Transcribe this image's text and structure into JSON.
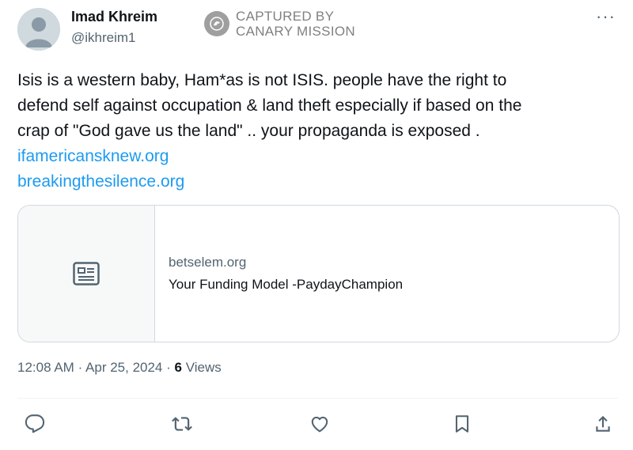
{
  "author": {
    "name": "Imad Khreim",
    "handle": "@ikhreim1"
  },
  "watermark": {
    "line1": "CAPTURED BY",
    "line2": "CANARY MISSION"
  },
  "more_label": "···",
  "tweet": {
    "line1": "Isis is a western baby, Ham*as is not ISIS.  people have the right to",
    "line2": "defend self against occupation & land theft especially if based on the",
    "line3": "crap of \"God gave us the land\"  .. your propaganda is exposed .",
    "link1": "ifamericansknew.org",
    "link2": "breakingthesilence.org"
  },
  "card": {
    "domain": "betselem.org",
    "title": "Your Funding Model -PaydayChampion",
    "icon": "article-icon"
  },
  "meta": {
    "time": "12:08 AM",
    "separator": "·",
    "date": "Apr 25, 2024",
    "views_count": "6",
    "views_label": "Views"
  },
  "actions": [
    "reply-icon",
    "retweet-icon",
    "like-icon",
    "bookmark-icon",
    "share-icon"
  ],
  "colors": {
    "link": "#1d9bf0",
    "secondary_text": "#536471",
    "border": "#cfd9de"
  }
}
